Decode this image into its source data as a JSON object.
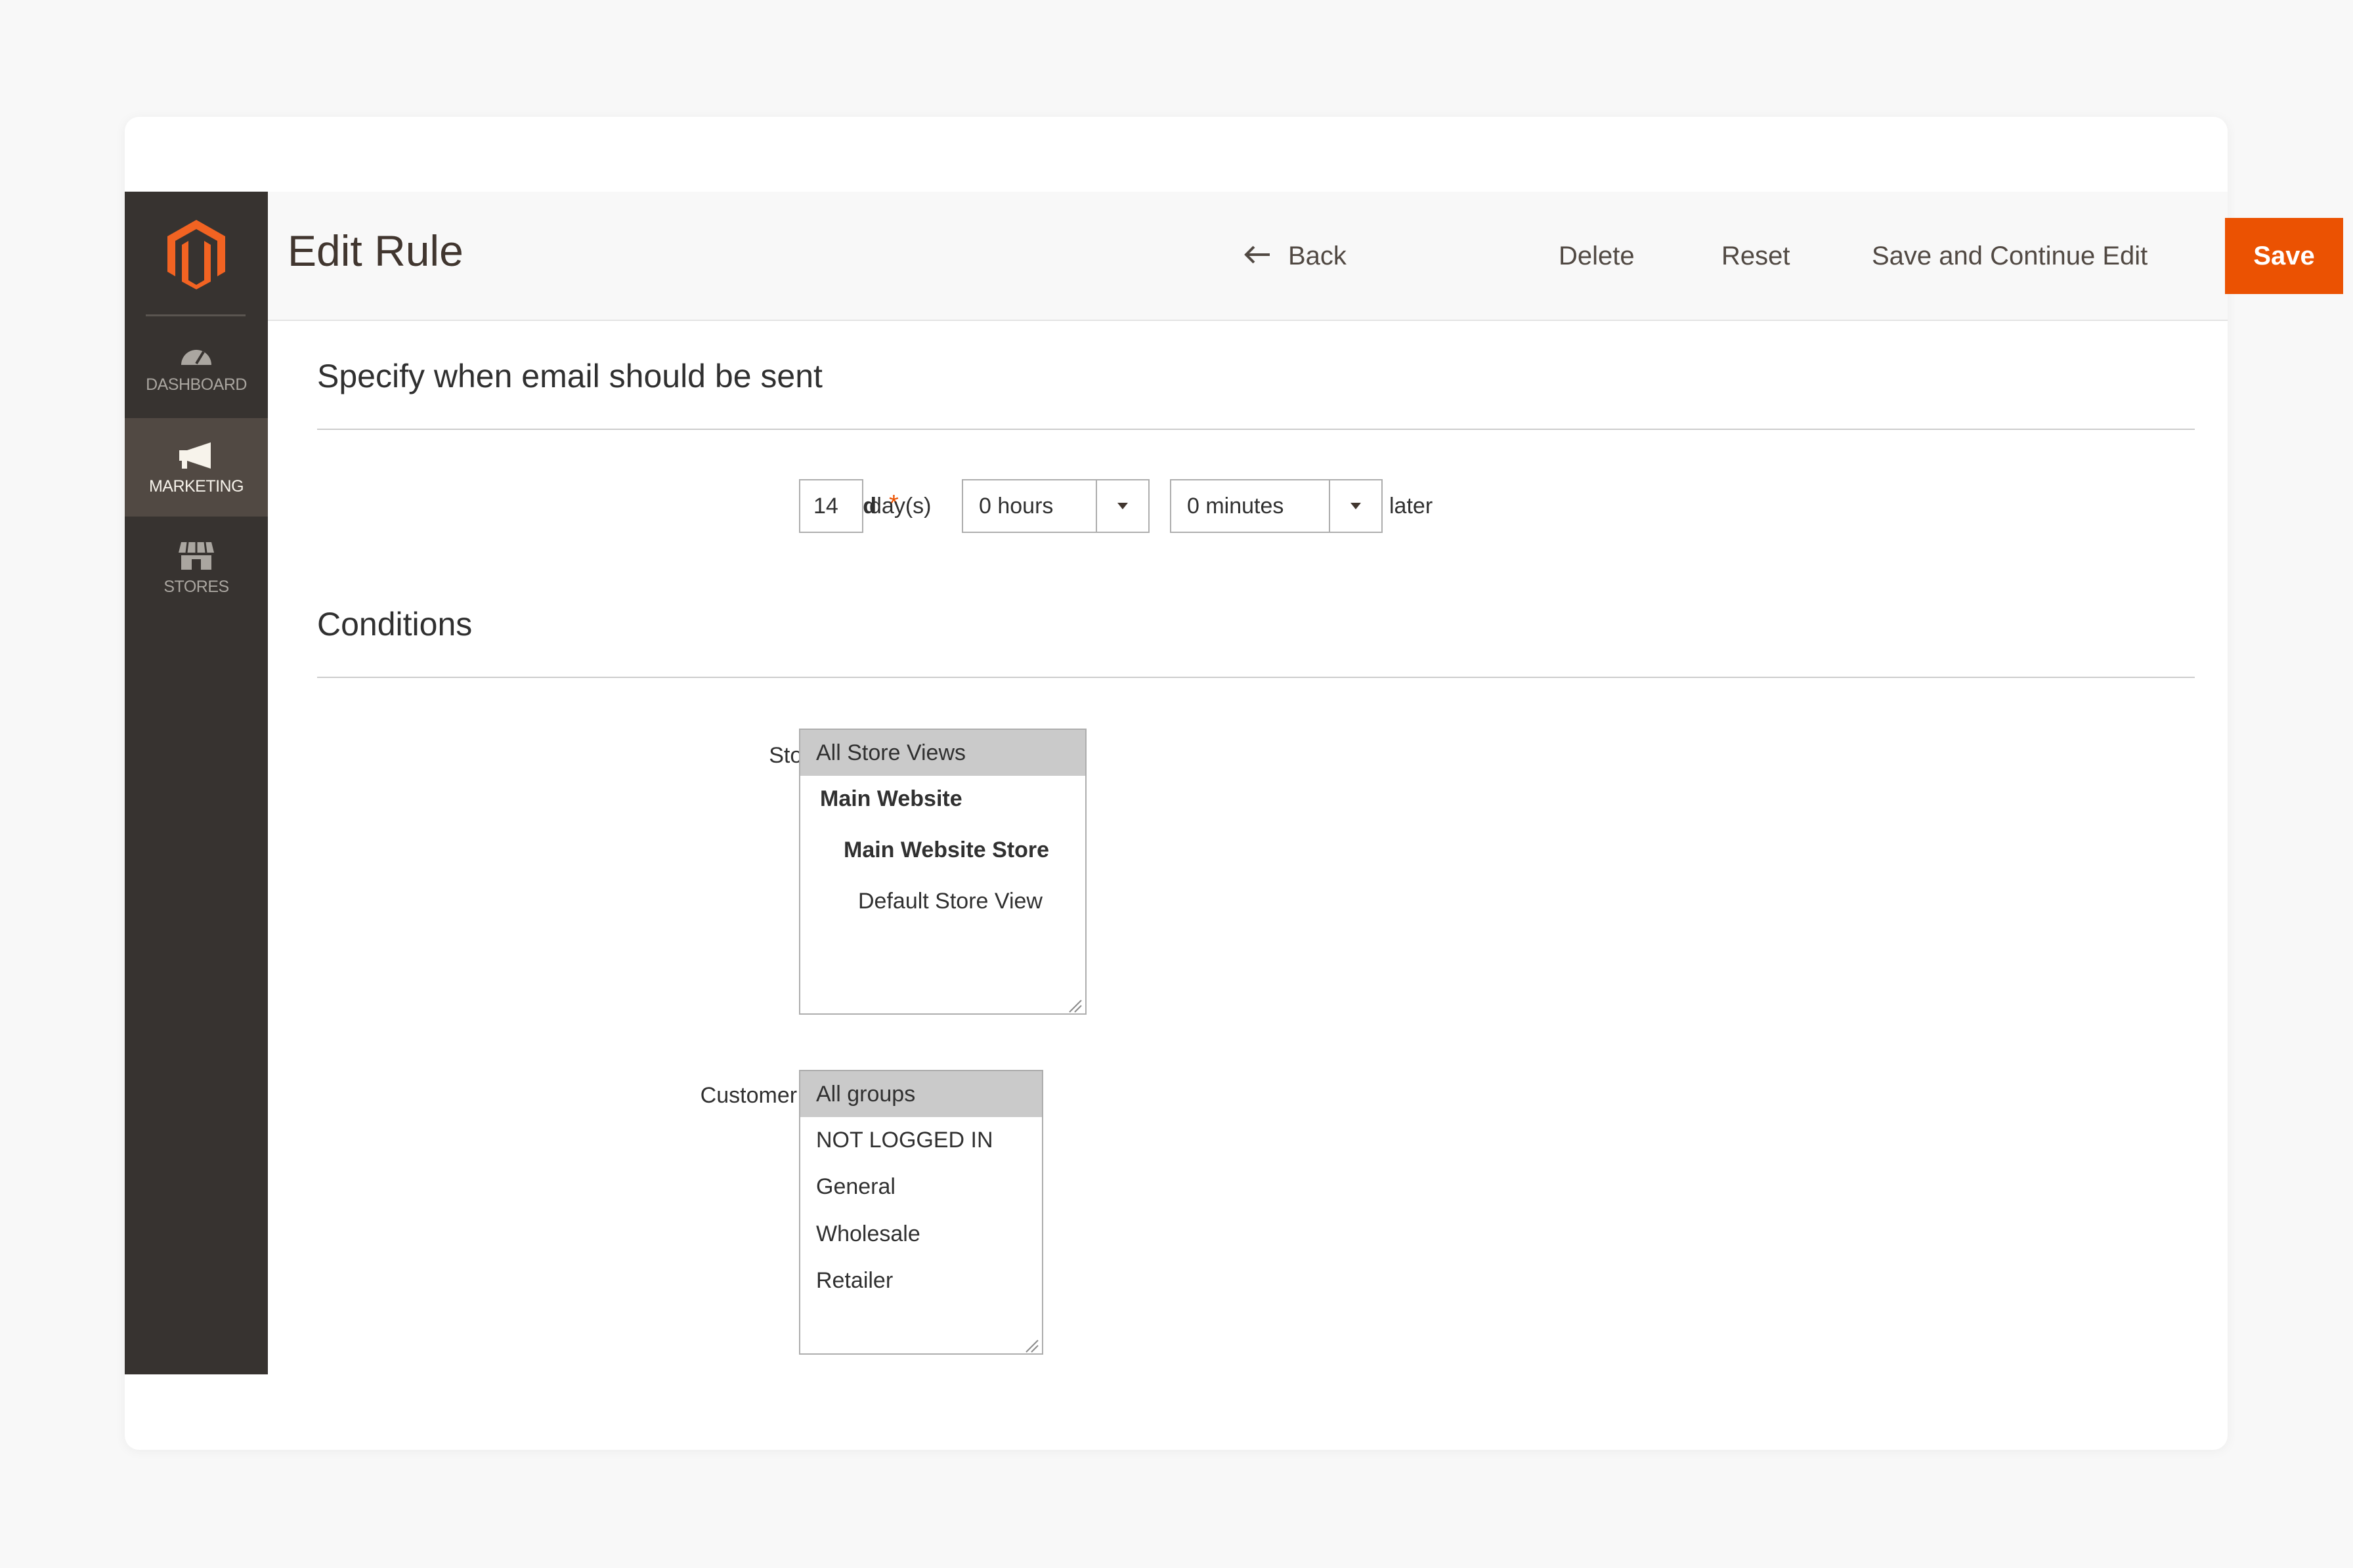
{
  "app": {
    "logo": "magento-logo",
    "accent_color": "#eb5202",
    "sidebar": [
      {
        "label": "DASHBOARD",
        "icon": "dashboard-icon",
        "active": false
      },
      {
        "label": "MARKETING",
        "icon": "megaphone-icon",
        "active": true
      },
      {
        "label": "STORES",
        "icon": "store-icon",
        "active": false
      }
    ]
  },
  "header": {
    "title": "Edit Rule",
    "back_label": "Back",
    "delete_label": "Delete",
    "reset_label": "Reset",
    "save_continue_label": "Save and Continue Edit",
    "save_label": "Save"
  },
  "send_section": {
    "title": "Specify when email should be sent",
    "send_label": "Send",
    "required_mark": "*",
    "days_value": "14",
    "days_unit": "day(s)",
    "hours_value": "0 hours",
    "minutes_value": "0 minutes",
    "later_label": "later"
  },
  "conditions": {
    "title": "Conditions",
    "store_view_label": "Store View",
    "store_view_options": [
      {
        "label": "All Store Views",
        "selected": true,
        "bold": false,
        "indent": 0
      },
      {
        "label": "Main Website",
        "selected": false,
        "bold": true,
        "indent": 1
      },
      {
        "label": "Main Website Store",
        "selected": false,
        "bold": true,
        "indent": 2
      },
      {
        "label": "Default Store View",
        "selected": false,
        "bold": false,
        "indent": 3
      }
    ],
    "customer_groups_label": "Customer Groups",
    "customer_group_options": [
      {
        "label": "All groups",
        "selected": true
      },
      {
        "label": "NOT LOGGED IN",
        "selected": false
      },
      {
        "label": "General",
        "selected": false
      },
      {
        "label": "Wholesale",
        "selected": false
      },
      {
        "label": "Retailer",
        "selected": false
      }
    ]
  }
}
